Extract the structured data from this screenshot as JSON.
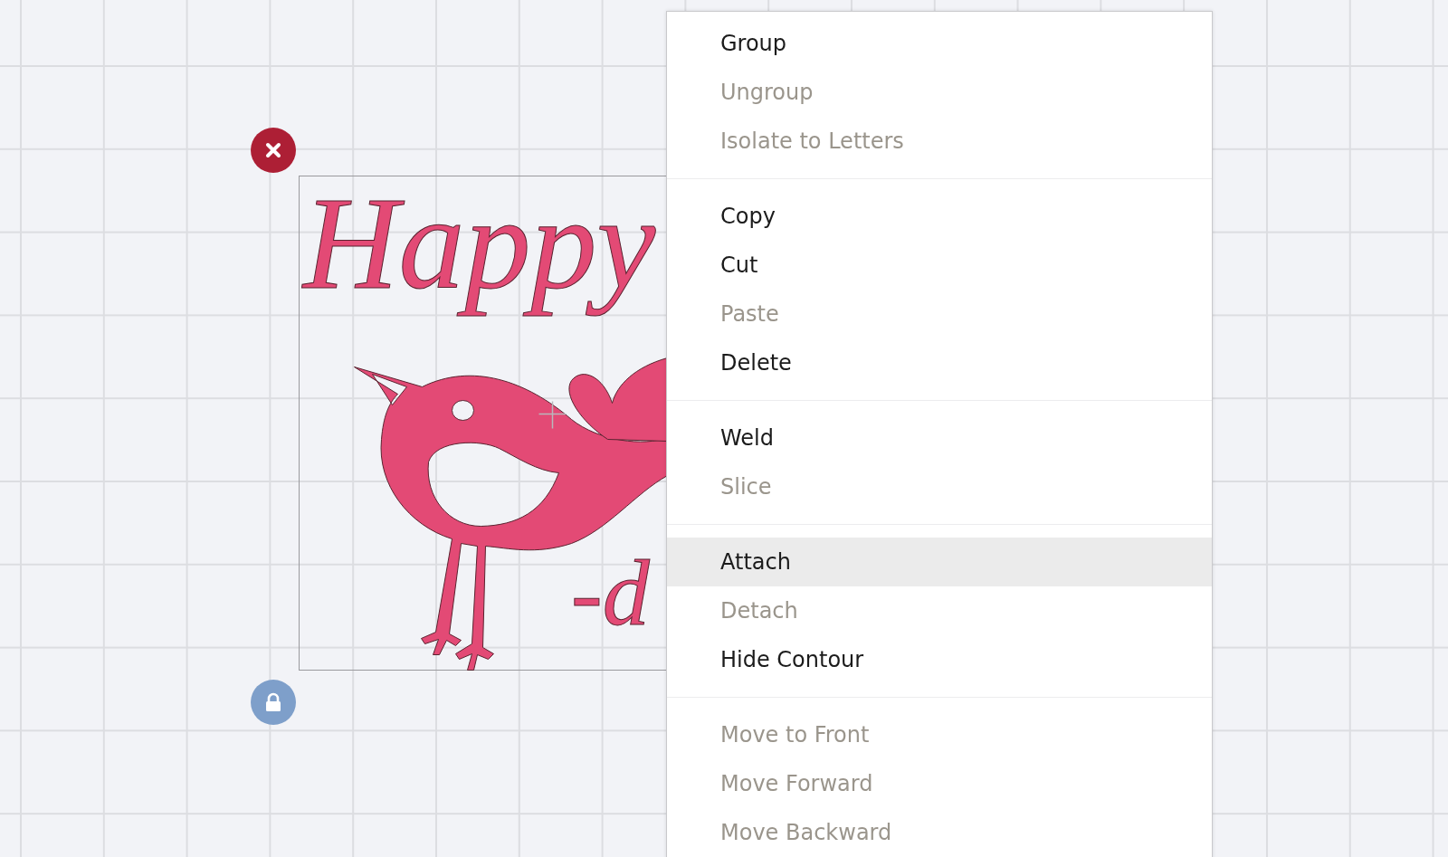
{
  "artwork": {
    "lettering": [
      "Happy",
      "-d"
    ]
  },
  "context_menu": {
    "groups": [
      [
        {
          "label": "Group",
          "disabled": false,
          "selected": false
        },
        {
          "label": "Ungroup",
          "disabled": true,
          "selected": false
        },
        {
          "label": "Isolate to Letters",
          "disabled": true,
          "selected": false
        }
      ],
      [
        {
          "label": "Copy",
          "disabled": false,
          "selected": false
        },
        {
          "label": "Cut",
          "disabled": false,
          "selected": false
        },
        {
          "label": "Paste",
          "disabled": true,
          "selected": false
        },
        {
          "label": "Delete",
          "disabled": false,
          "selected": false
        }
      ],
      [
        {
          "label": "Weld",
          "disabled": false,
          "selected": false
        },
        {
          "label": "Slice",
          "disabled": true,
          "selected": false
        }
      ],
      [
        {
          "label": "Attach",
          "disabled": false,
          "selected": true
        },
        {
          "label": "Detach",
          "disabled": true,
          "selected": false
        },
        {
          "label": "Hide Contour",
          "disabled": false,
          "selected": false
        }
      ],
      [
        {
          "label": "Move to Front",
          "disabled": true,
          "selected": false
        },
        {
          "label": "Move Forward",
          "disabled": true,
          "selected": false
        },
        {
          "label": "Move Backward",
          "disabled": true,
          "selected": false
        }
      ]
    ]
  }
}
